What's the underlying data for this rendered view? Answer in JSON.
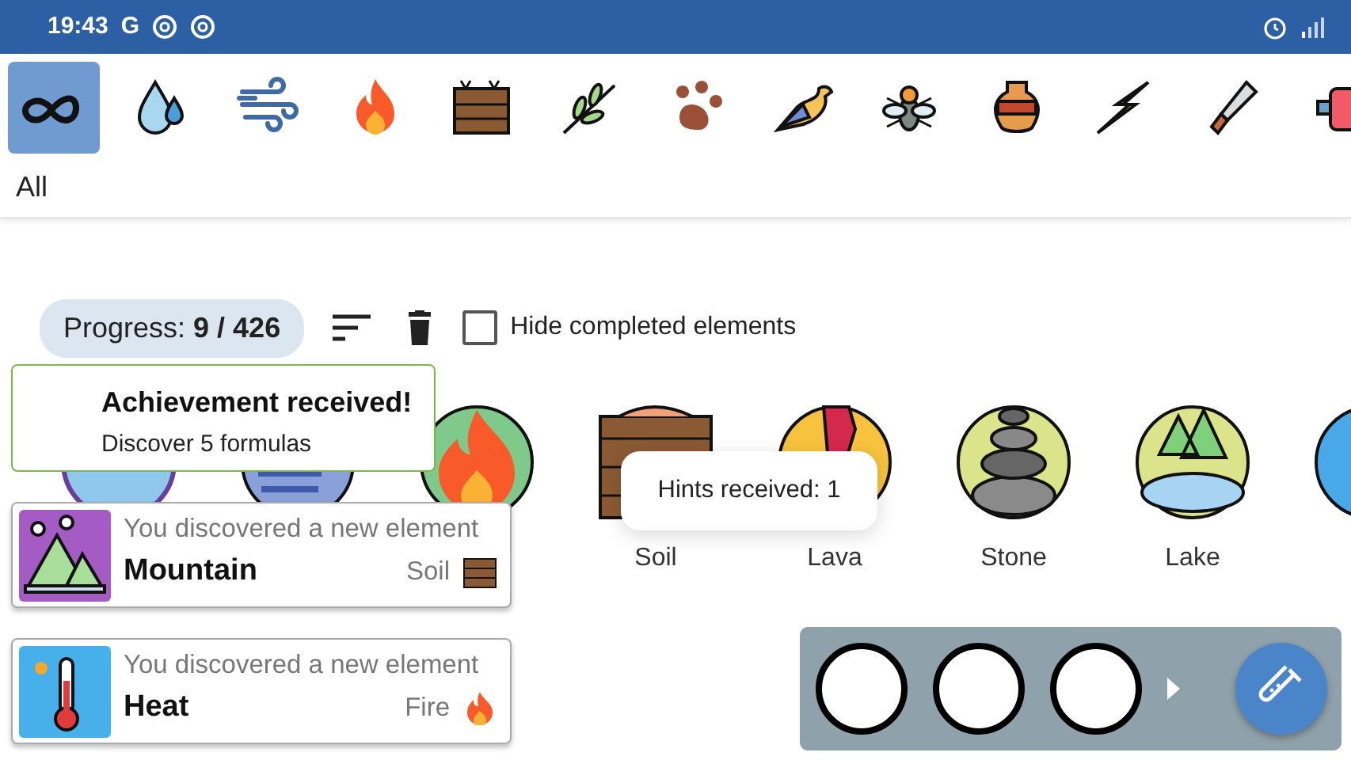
{
  "status_bar": {
    "time": "19:43",
    "notification_icons": [
      "G"
    ]
  },
  "categories": [
    {
      "selected": true
    },
    {
      "selected": false
    },
    {
      "selected": false
    },
    {
      "selected": false
    },
    {
      "selected": false
    },
    {
      "selected": false
    },
    {
      "selected": false
    },
    {
      "selected": false
    },
    {
      "selected": false
    },
    {
      "selected": false
    },
    {
      "selected": false
    },
    {
      "selected": false
    },
    {
      "selected": false
    }
  ],
  "category_label": "All",
  "toolbar": {
    "progress": "Progress: **9 / 426**",
    "hide_completed": {
      "label": "Hide completed elements",
      "checked": false
    }
  },
  "elements": [
    {
      "name": "Soil"
    },
    {
      "name": "Lava"
    },
    {
      "name": "Stone"
    },
    {
      "name": "Lake"
    }
  ],
  "achievement": {
    "title": "Achievement received!",
    "text": "Discover 5 formulas"
  },
  "discoveries": [
    {
      "intro": "You discovered a new element",
      "name": "Mountain",
      "source": "Soil"
    },
    {
      "intro": "You discovered a new element",
      "name": "Heat",
      "source": "Fire"
    }
  ],
  "hint_toast": {
    "text": "Hints received: 1"
  },
  "mixer": {
    "slots": [
      {
        "filled": false
      },
      {
        "filled": false
      },
      {
        "filled": false
      }
    ]
  }
}
